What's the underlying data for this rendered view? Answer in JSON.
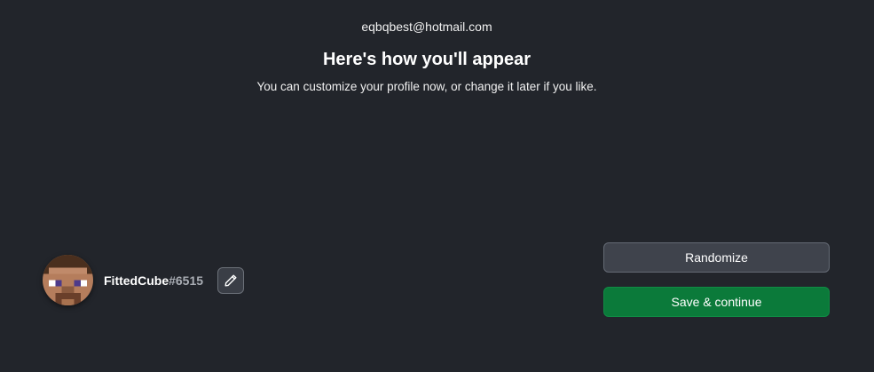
{
  "account": {
    "email": "eqbqbest@hotmail.com"
  },
  "heading": {
    "title": "Here's how you'll appear",
    "subtitle": "You can customize your profile now, or change it later if you like."
  },
  "profile": {
    "username": "FittedCube",
    "tag": "#6515",
    "avatar_icon": "minecraft-steve-face-icon",
    "edit_icon": "pencil-icon"
  },
  "actions": {
    "randomize_label": "Randomize",
    "save_label": "Save & continue"
  },
  "colors": {
    "background": "#22252b",
    "primary_button": "#0b7a3a",
    "secondary_button": "#3f434c"
  }
}
